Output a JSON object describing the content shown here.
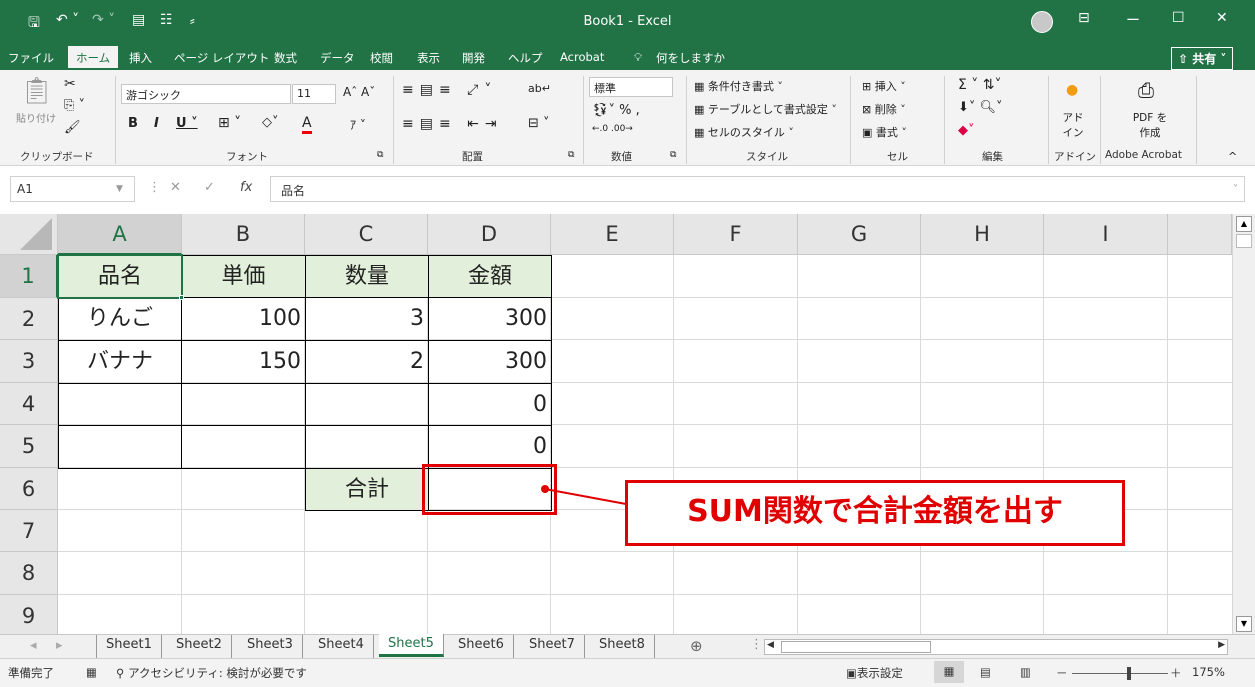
{
  "window": {
    "title": "Book1 - Excel",
    "min": "ー",
    "max": "☐",
    "close": "✕"
  },
  "menu": [
    "ファイル",
    "ホーム",
    "挿入",
    "ページ レイアウト",
    "数式",
    "データ",
    "校閲",
    "表示",
    "開発",
    "ヘルプ",
    "Acrobat"
  ],
  "menu_active": "ホーム",
  "tell_me": "何をしますか",
  "share": "共有",
  "ribbon": {
    "clipboard_label": "クリップボード",
    "paste": "貼り付け",
    "font_label": "フォント",
    "font_name": "游ゴシック",
    "font_size": "11",
    "align_label": "配置",
    "number_label": "数値",
    "number_format": "標準",
    "style_label": "スタイル",
    "conditional": "条件付き書式",
    "table_format": "テーブルとして書式設定",
    "cell_style": "セルのスタイル",
    "cells_label": "セル",
    "insert": "挿入",
    "delete": "削除",
    "format": "書式",
    "edit_label": "編集",
    "addin_label": "アドイン",
    "addin": "アド イン",
    "acrobat_label": "Adobe Acrobat",
    "pdf": "PDF を作成"
  },
  "namebox": "A1",
  "formula": "品名",
  "columns": [
    "A",
    "B",
    "C",
    "D",
    "E",
    "F",
    "G",
    "H",
    "I"
  ],
  "rows": [
    "1",
    "2",
    "3",
    "4",
    "5",
    "6",
    "7",
    "8",
    "9"
  ],
  "cells": {
    "A1": "品名",
    "B1": "単価",
    "C1": "数量",
    "D1": "金額",
    "A2": "りんご",
    "B2": "100",
    "C2": "3",
    "D2": "300",
    "A3": "バナナ",
    "B3": "150",
    "C3": "2",
    "D3": "300",
    "D4": "0",
    "D5": "0",
    "C6": "合計"
  },
  "callout": "SUM関数で合計金額を出す",
  "sheets": [
    "Sheet1",
    "Sheet2",
    "Sheet3",
    "Sheet4",
    "Sheet5",
    "Sheet6",
    "Sheet7",
    "Sheet8"
  ],
  "active_sheet": "Sheet5",
  "status": {
    "ready": "準備完了",
    "accessibility": "アクセシビリティ: 検討が必要です",
    "display_settings": "表示設定",
    "zoom": "175%"
  },
  "colors": {
    "excel_green": "#217346",
    "header_fill": "#e2efda",
    "callout_red": "#e00000"
  }
}
